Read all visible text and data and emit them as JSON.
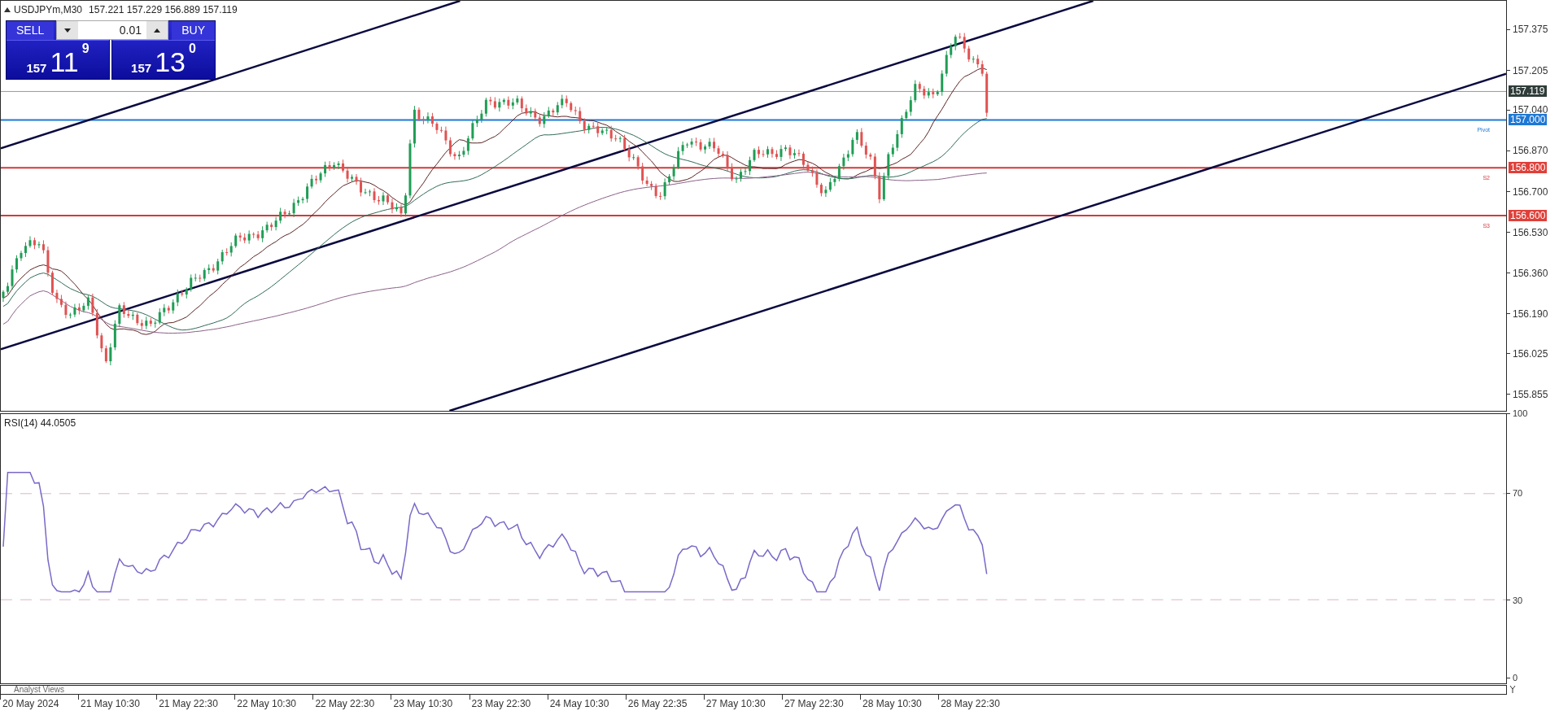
{
  "chart_header": {
    "symbol": "USDJPYm,M30",
    "ohlc": "157.221 157.229 156.889 157.119"
  },
  "trade_panel": {
    "sell": {
      "label": "SELL",
      "price_prefix": "157",
      "price_main": "11",
      "price_pip": "9"
    },
    "lot": {
      "value": "0.01"
    },
    "buy": {
      "label": "BUY",
      "price_prefix": "157",
      "price_main": "13",
      "price_pip": "0"
    }
  },
  "price_axis": {
    "ticks": [
      "157.375",
      "157.205",
      "157.040",
      "156.870",
      "156.700",
      "156.530",
      "156.360",
      "156.190",
      "156.025",
      "155.855"
    ]
  },
  "levels": [
    {
      "kind": "current",
      "value": "157.119"
    },
    {
      "kind": "pivot",
      "value": "157.000",
      "label": "Pivot"
    },
    {
      "kind": "support",
      "value": "156.800",
      "label": "S2"
    },
    {
      "kind": "support",
      "value": "156.600",
      "label": "S3"
    }
  ],
  "rsi": {
    "title": "RSI(14) 44.0505",
    "ticks": [
      "100",
      "70",
      "30",
      "0"
    ]
  },
  "bottom_strip": {
    "label": "Analyst Views"
  },
  "time_axis": {
    "labels": [
      "20 May 2024",
      "21 May 10:30",
      "21 May 22:30",
      "22 May 10:30",
      "22 May 22:30",
      "23 May 10:30",
      "23 May 22:30",
      "24 May 10:30",
      "26 May 22:35",
      "27 May 10:30",
      "27 May 22:30",
      "28 May 10:30",
      "28 May 22:30"
    ]
  }
}
